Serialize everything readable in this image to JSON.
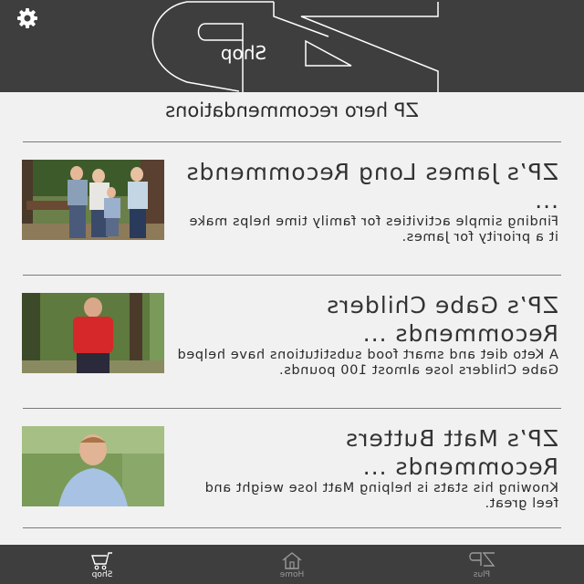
{
  "header": {
    "logo_text": "Shop",
    "settings_icon": "gear-icon",
    "logo_icon": "zp-logo-icon"
  },
  "section": {
    "title": "ZP hero recommendations"
  },
  "cards": [
    {
      "title": "ZP’s James Long Recommends ...",
      "description": "Finding simple activities for family time helps make it a priority for James.",
      "photo": "family-photo"
    },
    {
      "title": "ZP’s Gabe Childers Recommends ...",
      "description": "A Keto diet and smart food substitutions have helped Gabe Childers lose almost 100 pounds.",
      "photo": "man-red-shirt-photo"
    },
    {
      "title": "ZP’s Matt Butters Recommends ...",
      "description": "Knowing his stats is helping Matt lose weight and feel great.",
      "photo": "man-blue-shirt-photo"
    }
  ],
  "tabbar": {
    "tabs": [
      {
        "label": "Shop",
        "icon": "cart-icon",
        "active": true
      },
      {
        "label": "Home",
        "icon": "home-icon",
        "active": false
      },
      {
        "label": "Plus",
        "icon": "zp-plus-icon",
        "active": false
      }
    ],
    "active_color": "#ffffff",
    "inactive_color": "#9a9a9a"
  },
  "colors": {
    "header_bg": "#3e3e3e",
    "page_bg": "#f1f1f1"
  }
}
